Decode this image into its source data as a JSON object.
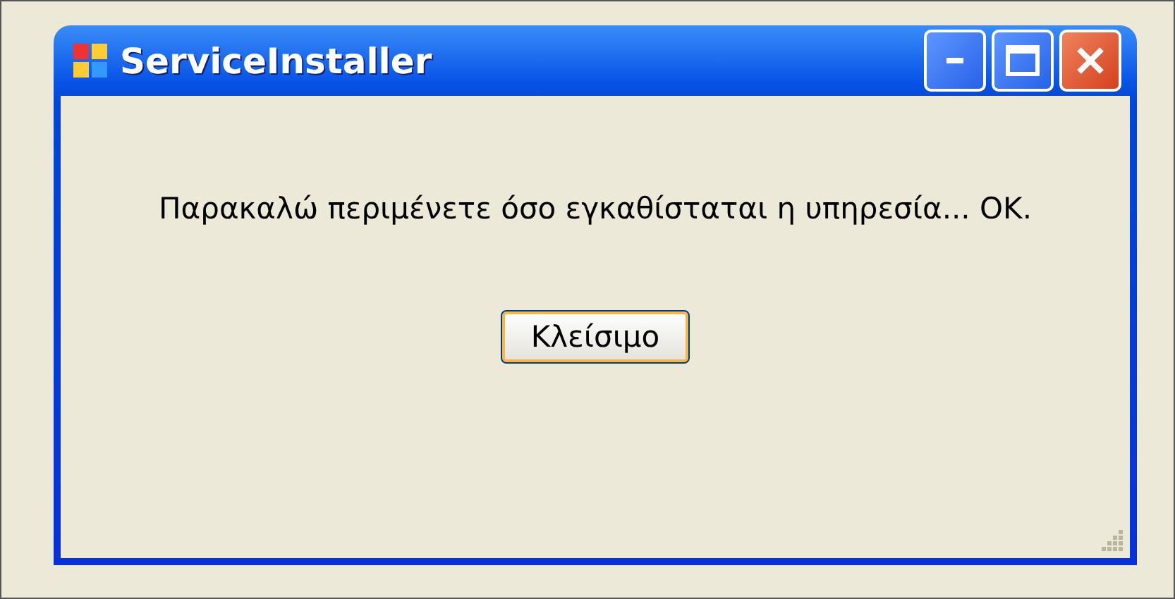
{
  "window": {
    "title": "ServiceInstaller"
  },
  "message": "Παρακαλώ περιμένετε όσο εγκαθίσταται η υπηρεσία... OK.",
  "buttons": [
    {
      "label": "Κλείσιμο",
      "default": true
    }
  ]
}
